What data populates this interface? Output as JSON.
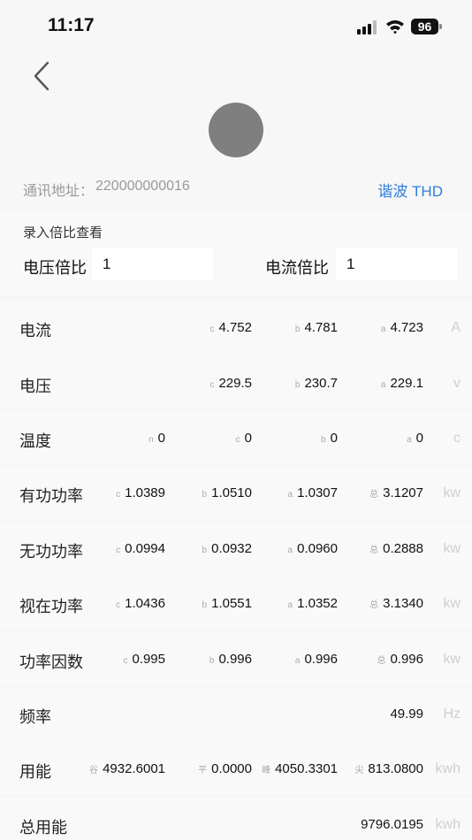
{
  "status_bar": {
    "time": "11:17",
    "battery": "96"
  },
  "header": {
    "address_label": "通讯地址：",
    "address_value": "220000000016",
    "thd_link": "谐波 THD"
  },
  "ratio": {
    "title": "录入倍比查看",
    "voltage_label": "电压倍比",
    "voltage_value": "1",
    "current_label": "电流倍比",
    "current_value": "1"
  },
  "rows": [
    {
      "label": "电流",
      "unit": "A",
      "cells": [
        {
          "tag": "c",
          "value": "4.752"
        },
        {
          "tag": "b",
          "value": "4.781"
        },
        {
          "tag": "a",
          "value": "4.723"
        }
      ]
    },
    {
      "label": "电压",
      "unit": "v",
      "cells": [
        {
          "tag": "c",
          "value": "229.5"
        },
        {
          "tag": "b",
          "value": "230.7"
        },
        {
          "tag": "a",
          "value": "229.1"
        }
      ]
    },
    {
      "label": "温度",
      "unit": "c",
      "cells": [
        {
          "tag": "n",
          "value": "0"
        },
        {
          "tag": "c",
          "value": "0"
        },
        {
          "tag": "b",
          "value": "0"
        },
        {
          "tag": "a",
          "value": "0"
        }
      ]
    },
    {
      "label": "有功功率",
      "unit": "kw",
      "cells": [
        {
          "tag": "c",
          "value": "1.0389"
        },
        {
          "tag": "b",
          "value": "1.0510"
        },
        {
          "tag": "a",
          "value": "1.0307"
        },
        {
          "tag": "总",
          "value": "3.1207"
        }
      ]
    },
    {
      "label": "无功功率",
      "unit": "kw",
      "cells": [
        {
          "tag": "c",
          "value": "0.0994"
        },
        {
          "tag": "b",
          "value": "0.0932"
        },
        {
          "tag": "a",
          "value": "0.0960"
        },
        {
          "tag": "总",
          "value": "0.2888"
        }
      ]
    },
    {
      "label": "视在功率",
      "unit": "kw",
      "cells": [
        {
          "tag": "c",
          "value": "1.0436"
        },
        {
          "tag": "b",
          "value": "1.0551"
        },
        {
          "tag": "a",
          "value": "1.0352"
        },
        {
          "tag": "总",
          "value": "3.1340"
        }
      ]
    },
    {
      "label": "功率因数",
      "unit": "kw",
      "cells": [
        {
          "tag": "c",
          "value": "0.995"
        },
        {
          "tag": "b",
          "value": "0.996"
        },
        {
          "tag": "a",
          "value": "0.996"
        },
        {
          "tag": "总",
          "value": "0.996"
        }
      ]
    },
    {
      "label": "频率",
      "unit": "Hz",
      "cells": [
        {
          "tag": "",
          "value": "49.99"
        }
      ]
    },
    {
      "label": "用能",
      "unit": "kwh",
      "cells": [
        {
          "tag": "谷",
          "value": "4932.6001"
        },
        {
          "tag": "平",
          "value": "0.0000"
        },
        {
          "tag": "峰",
          "value": "4050.3301"
        },
        {
          "tag": "尖",
          "value": "813.0800"
        }
      ]
    },
    {
      "label": "总用能",
      "unit": "kwh",
      "cells": [
        {
          "tag": "",
          "value": "9796.0195"
        }
      ]
    }
  ]
}
